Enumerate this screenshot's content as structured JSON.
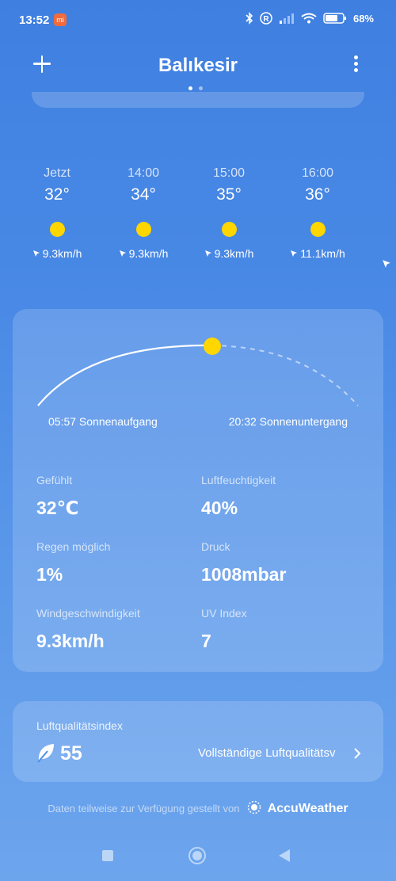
{
  "status_bar": {
    "time": "13:52",
    "battery_percent": "68%",
    "icons": [
      "bluetooth-icon",
      "registered-icon",
      "signal-icon",
      "wifi-icon",
      "battery-icon"
    ]
  },
  "header": {
    "city": "Balıkesir",
    "page_count": 2,
    "active_page": 1
  },
  "hourly": [
    {
      "label": "Jetzt",
      "temp": "32°",
      "icon": "sun-icon",
      "wind": "9.3km/h"
    },
    {
      "label": "14:00",
      "temp": "34°",
      "icon": "sun-icon",
      "wind": "9.3km/h"
    },
    {
      "label": "15:00",
      "temp": "35°",
      "icon": "sun-icon",
      "wind": "9.3km/h"
    },
    {
      "label": "16:00",
      "temp": "36°",
      "icon": "sun-icon",
      "wind": "11.1km/h"
    }
  ],
  "sun": {
    "sunrise": "05:57 Sonnenaufgang",
    "sunset": "20:32 Sonnenuntergang",
    "day_progress": 0.5
  },
  "details": {
    "feels_label": "Gefühlt",
    "feels_value": "32℃",
    "humidity_label": "Luftfeuchtigkeit",
    "humidity_value": "40%",
    "rain_label": "Regen möglich",
    "rain_value": "1%",
    "pressure_label": "Druck",
    "pressure_value": "1008mbar",
    "wind_label": "Windgeschwindigkeit",
    "wind_value": "9.3km/h",
    "uv_label": "UV Index",
    "uv_value": "7"
  },
  "aqi": {
    "title": "Luftqualitätsindex",
    "value": "55",
    "link": "Vollständige Luftqualitätsv"
  },
  "footer": {
    "text": "Daten teilweise zur Verfügung gestellt von",
    "brand": "AccuWeather"
  },
  "colors": {
    "sun": "#ffd600",
    "background_top": "#3f7fe0",
    "background_bottom": "#6da5ed"
  }
}
